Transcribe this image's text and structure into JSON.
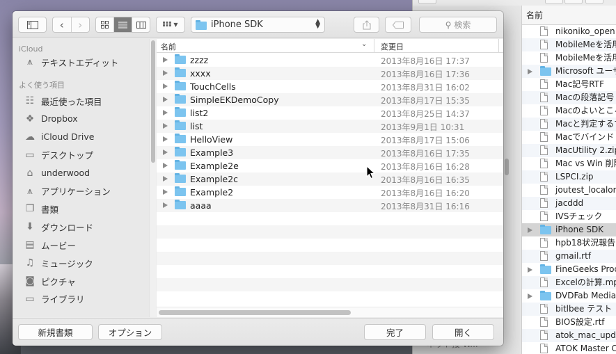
{
  "background_window": {
    "list_header": "名前",
    "items": [
      {
        "name": "nikoniko_open",
        "type": "doc",
        "expandable": false
      },
      {
        "name": "MobileMeを活用",
        "type": "doc",
        "expandable": false
      },
      {
        "name": "MobileMeを活用",
        "type": "doc",
        "expandable": false
      },
      {
        "name": "Microsoft ユーザ",
        "type": "folder",
        "expandable": true
      },
      {
        "name": "Mac記号RTF",
        "type": "doc",
        "expandable": false
      },
      {
        "name": "Macの段落記号",
        "type": "doc",
        "expandable": false
      },
      {
        "name": "Macのよいところ",
        "type": "doc",
        "expandable": false
      },
      {
        "name": "Macと判定するす",
        "type": "doc",
        "expandable": false
      },
      {
        "name": "Macでバインド",
        "type": "doc",
        "expandable": false
      },
      {
        "name": "MacUtility 2.zip",
        "type": "doc",
        "expandable": false
      },
      {
        "name": "Mac vs Win 削除",
        "type": "doc",
        "expandable": false
      },
      {
        "name": "LSPCI.zip",
        "type": "doc",
        "expandable": false
      },
      {
        "name": "joutest_localonl",
        "type": "doc",
        "expandable": false
      },
      {
        "name": "jacddd",
        "type": "doc",
        "expandable": false
      },
      {
        "name": "IVSチェック",
        "type": "doc",
        "expandable": false
      },
      {
        "name": "iPhone SDK",
        "type": "folder",
        "expandable": true,
        "selected": true
      },
      {
        "name": "hpb18状況報告",
        "type": "doc",
        "expandable": false
      },
      {
        "name": "gmail.rtf",
        "type": "doc",
        "expandable": false
      },
      {
        "name": "FineGeeks Prod",
        "type": "folder",
        "expandable": true
      },
      {
        "name": "Excelの計算.mp",
        "type": "doc",
        "expandable": false
      },
      {
        "name": "DVDFab Media",
        "type": "folder",
        "expandable": true
      },
      {
        "name": "bitlbee テスト",
        "type": "doc",
        "expandable": false
      },
      {
        "name": "BIOS設定.rtf",
        "type": "doc",
        "expandable": false
      },
      {
        "name": "atok_mac_upda",
        "type": "doc",
        "expandable": false
      },
      {
        "name": "ATOK Master C",
        "type": "doc",
        "expandable": false
      }
    ],
    "bottom_text": "ネット接 W..."
  },
  "toolbar": {
    "path_folder": "iPhone SDK",
    "search_placeholder": "検索"
  },
  "sidebar": {
    "sections": [
      {
        "title": "iCloud",
        "items": [
          {
            "label": "テキストエディット",
            "icon": "app-icon"
          }
        ]
      },
      {
        "title": "よく使う項目",
        "items": [
          {
            "label": "最近使った項目",
            "icon": "recent-icon"
          },
          {
            "label": "Dropbox",
            "icon": "dropbox-icon"
          },
          {
            "label": "iCloud Drive",
            "icon": "cloud-icon"
          },
          {
            "label": "デスクトップ",
            "icon": "desktop-icon"
          },
          {
            "label": "underwood",
            "icon": "home-icon"
          },
          {
            "label": "アプリケーション",
            "icon": "applications-icon"
          },
          {
            "label": "書類",
            "icon": "documents-icon"
          },
          {
            "label": "ダウンロード",
            "icon": "download-icon"
          },
          {
            "label": "ムービー",
            "icon": "movies-icon"
          },
          {
            "label": "ミュージック",
            "icon": "music-icon"
          },
          {
            "label": "ピクチャ",
            "icon": "pictures-icon"
          },
          {
            "label": "ライブラリ",
            "icon": "library-folder-icon"
          }
        ]
      }
    ]
  },
  "file_list": {
    "col_name": "名前",
    "col_date": "変更日",
    "rows": [
      {
        "name": "zzzz",
        "date": "2013年8月16日 17:37"
      },
      {
        "name": "xxxx",
        "date": "2013年8月16日 17:36"
      },
      {
        "name": "TouchCells",
        "date": "2013年8月31日 16:02"
      },
      {
        "name": "SimpleEKDemoCopy",
        "date": "2013年8月17日 15:35"
      },
      {
        "name": "list2",
        "date": "2013年8月25日 14:37"
      },
      {
        "name": "list",
        "date": "2013年9月1日 10:31"
      },
      {
        "name": "HelloView",
        "date": "2013年8月17日 15:06"
      },
      {
        "name": "Example3",
        "date": "2013年8月16日 17:35"
      },
      {
        "name": "Example2e",
        "date": "2013年8月16日 16:28"
      },
      {
        "name": "Example2c",
        "date": "2013年8月16日 16:35"
      },
      {
        "name": "Example2",
        "date": "2013年8月16日 16:20"
      },
      {
        "name": "aaaa",
        "date": "2013年8月31日 16:16"
      }
    ]
  },
  "buttons": {
    "new_folder": "新規書類",
    "options": "オプション",
    "done": "完了",
    "open": "開く"
  }
}
